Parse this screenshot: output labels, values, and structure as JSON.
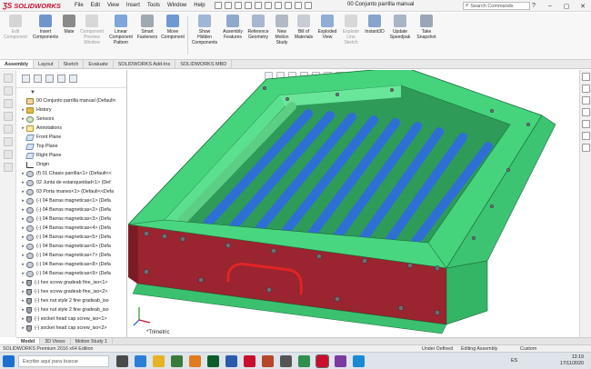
{
  "app": {
    "brand": "SOLIDWORKS",
    "document_title": "00 Conjunto parrilla manual",
    "menus": [
      "File",
      "Edit",
      "View",
      "Insert",
      "Tools",
      "Window",
      "Help"
    ],
    "search_placeholder": "Search Commands"
  },
  "commands": [
    {
      "label": "Edit\nComponent",
      "icon": "edit-component-icon",
      "disabled": true
    },
    {
      "label": "Insert\nComponents",
      "icon": "insert-components-icon",
      "disabled": false
    },
    {
      "label": "Mate",
      "icon": "mate-icon",
      "disabled": false
    },
    {
      "label": "Component\nPreview\nWindow",
      "icon": "component-preview-icon",
      "disabled": true
    },
    {
      "label": "Linear\nComponent\nPattern",
      "icon": "linear-pattern-icon",
      "disabled": false
    },
    {
      "label": "Smart\nFasteners",
      "icon": "smart-fasteners-icon",
      "disabled": false
    },
    {
      "label": "Move\nComponent",
      "icon": "move-component-icon",
      "disabled": false
    },
    {
      "label": "Show\nHidden\nComponents",
      "icon": "show-hidden-icon",
      "disabled": false
    },
    {
      "label": "Assembly\nFeatures",
      "icon": "assembly-features-icon",
      "disabled": false
    },
    {
      "label": "Reference\nGeometry",
      "icon": "reference-geometry-icon",
      "disabled": false
    },
    {
      "label": "New\nMotion\nStudy",
      "icon": "motion-study-icon",
      "disabled": false
    },
    {
      "label": "Bill of\nMaterials",
      "icon": "bom-icon",
      "disabled": false
    },
    {
      "label": "Exploded\nView",
      "icon": "exploded-view-icon",
      "disabled": false
    },
    {
      "label": "Explode\nLine\nSketch",
      "icon": "explode-line-icon",
      "disabled": true
    },
    {
      "label": "Instant3D",
      "icon": "instant3d-icon",
      "disabled": false
    },
    {
      "label": "Update\nSpeedpak",
      "icon": "speedpak-icon",
      "disabled": false
    },
    {
      "label": "Take\nSnapshot",
      "icon": "snapshot-icon",
      "disabled": false
    }
  ],
  "tabs": [
    "Assembly",
    "Layout",
    "Sketch",
    "Evaluate",
    "SOLIDWORKS Add-Ins",
    "SOLIDWORKS MBD"
  ],
  "tree": {
    "root": "00 Conjunto parrilla manual  (Default<",
    "items": [
      {
        "label": "History",
        "icon": "folder"
      },
      {
        "label": "Sensors",
        "icon": "sensor"
      },
      {
        "label": "Annotations",
        "icon": "annot"
      },
      {
        "label": "Front Plane",
        "icon": "plane"
      },
      {
        "label": "Top Plane",
        "icon": "plane"
      },
      {
        "label": "Right Plane",
        "icon": "plane"
      },
      {
        "label": "Origin",
        "icon": "origin"
      },
      {
        "label": "(f) 01 Chasis parrilla<1> (Default<<",
        "icon": "part"
      },
      {
        "label": "02 Junta de estanqueidad<1> (Def",
        "icon": "part"
      },
      {
        "label": "03 Porta imanes<1> (Default<<Defa",
        "icon": "part"
      },
      {
        "label": "(-) 04 Barras magneticas<1> (Defa",
        "icon": "part"
      },
      {
        "label": "(-) 04 Barras magneticas<2> (Defa",
        "icon": "part"
      },
      {
        "label": "(-) 04 Barras magneticas<3> (Defa",
        "icon": "part"
      },
      {
        "label": "(-) 04 Barras magneticas<4> (Defa",
        "icon": "part"
      },
      {
        "label": "(-) 04 Barras magneticas<5> (Defa",
        "icon": "part"
      },
      {
        "label": "(-) 04 Barras magneticas<6> (Defa",
        "icon": "part"
      },
      {
        "label": "(-) 04 Barras magneticas<7> (Defa",
        "icon": "part"
      },
      {
        "label": "(-) 04 Barras magneticas<8> (Defa",
        "icon": "part"
      },
      {
        "label": "(-) 04 Barras magneticas<9> (Defa",
        "icon": "part"
      },
      {
        "label": "(-) hex screw gradeab fine_iso<1>",
        "icon": "screw"
      },
      {
        "label": "(-) hex screw gradeab fine_iso<2>",
        "icon": "screw"
      },
      {
        "label": "(-) hex nut style 2 fine gradeab_iso",
        "icon": "screw"
      },
      {
        "label": "(-) hex nut style 2 fine gradeab_iso",
        "icon": "screw"
      },
      {
        "label": "(-) socket head cap screw_iso<1>",
        "icon": "screw"
      },
      {
        "label": "(-) socket head cap screw_iso<2>",
        "icon": "screw"
      }
    ]
  },
  "viewport": {
    "view_label": "*Trimetric"
  },
  "bottom_tabs": [
    "Model",
    "3D Views",
    "Motion Study 1"
  ],
  "status": {
    "edition": "SOLIDWORKS Premium 2016 x64 Edition",
    "state": "Under Defined",
    "mode": "Editing Assembly",
    "units": "Custom"
  },
  "taskbar": {
    "search_placeholder": "Escribe aquí para buscar",
    "language": "ES",
    "time": "13:19",
    "date": "17/11/2020"
  },
  "colors": {
    "frame_green": "#3fd07a",
    "bar_blue": "#2e6fd6",
    "plate_red": "#9a2430",
    "handle_red": "#e02424"
  }
}
